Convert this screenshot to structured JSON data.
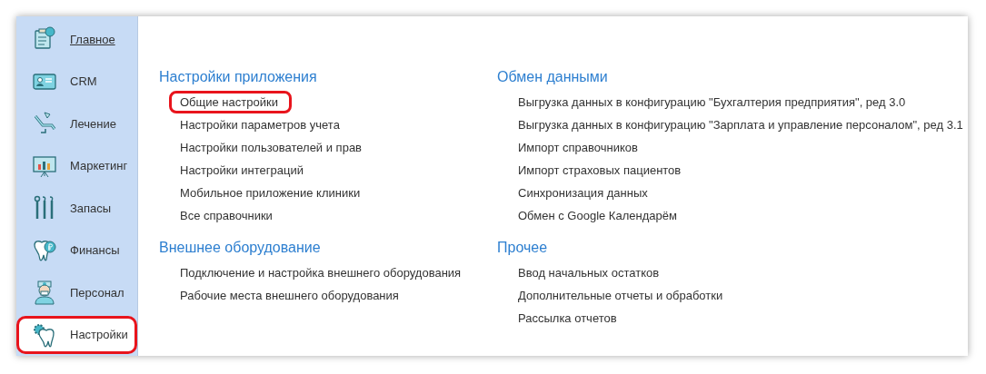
{
  "sidebar": {
    "items": [
      {
        "label": "Главное",
        "selected": true,
        "highlighted": false
      },
      {
        "label": "CRM",
        "selected": false,
        "highlighted": false
      },
      {
        "label": "Лечение",
        "selected": false,
        "highlighted": false
      },
      {
        "label": "Маркетинг",
        "selected": false,
        "highlighted": false
      },
      {
        "label": "Запасы",
        "selected": false,
        "highlighted": false
      },
      {
        "label": "Финансы",
        "selected": false,
        "highlighted": false
      },
      {
        "label": "Персонал",
        "selected": false,
        "highlighted": false
      },
      {
        "label": "Настройки",
        "selected": false,
        "highlighted": true
      }
    ]
  },
  "sections": [
    {
      "title": "Настройки приложения",
      "links": [
        {
          "label": "Общие настройки",
          "highlighted": true
        },
        {
          "label": "Настройки параметров учета",
          "highlighted": false
        },
        {
          "label": "Настройки пользователей и прав",
          "highlighted": false
        },
        {
          "label": "Настройки интеграций",
          "highlighted": false
        },
        {
          "label": "Мобильное приложение клиники",
          "highlighted": false
        },
        {
          "label": "Все справочники",
          "highlighted": false
        }
      ]
    },
    {
      "title": "Обмен данными",
      "links": [
        {
          "label": "Выгрузка данных в конфигурацию \"Бухгалтерия предприятия\", ред 3.0",
          "highlighted": false
        },
        {
          "label": "Выгрузка данных в конфигурацию \"Зарплата и управление персоналом\", ред 3.1",
          "highlighted": false
        },
        {
          "label": "Импорт справочников",
          "highlighted": false
        },
        {
          "label": "Импорт страховых пациентов",
          "highlighted": false
        },
        {
          "label": "Синхронизация данных",
          "highlighted": false
        },
        {
          "label": "Обмен с Google Календарём",
          "highlighted": false
        }
      ]
    },
    {
      "title": "Внешнее оборудование",
      "links": [
        {
          "label": "Подключение и настройка внешнего оборудования",
          "highlighted": false
        },
        {
          "label": "Рабочие места внешнего оборудования",
          "highlighted": false
        }
      ]
    },
    {
      "title": "Прочее",
      "links": [
        {
          "label": "Ввод начальных остатков",
          "highlighted": false
        },
        {
          "label": "Дополнительные отчеты и обработки",
          "highlighted": false
        },
        {
          "label": "Рассылка отчетов",
          "highlighted": false
        }
      ]
    }
  ]
}
